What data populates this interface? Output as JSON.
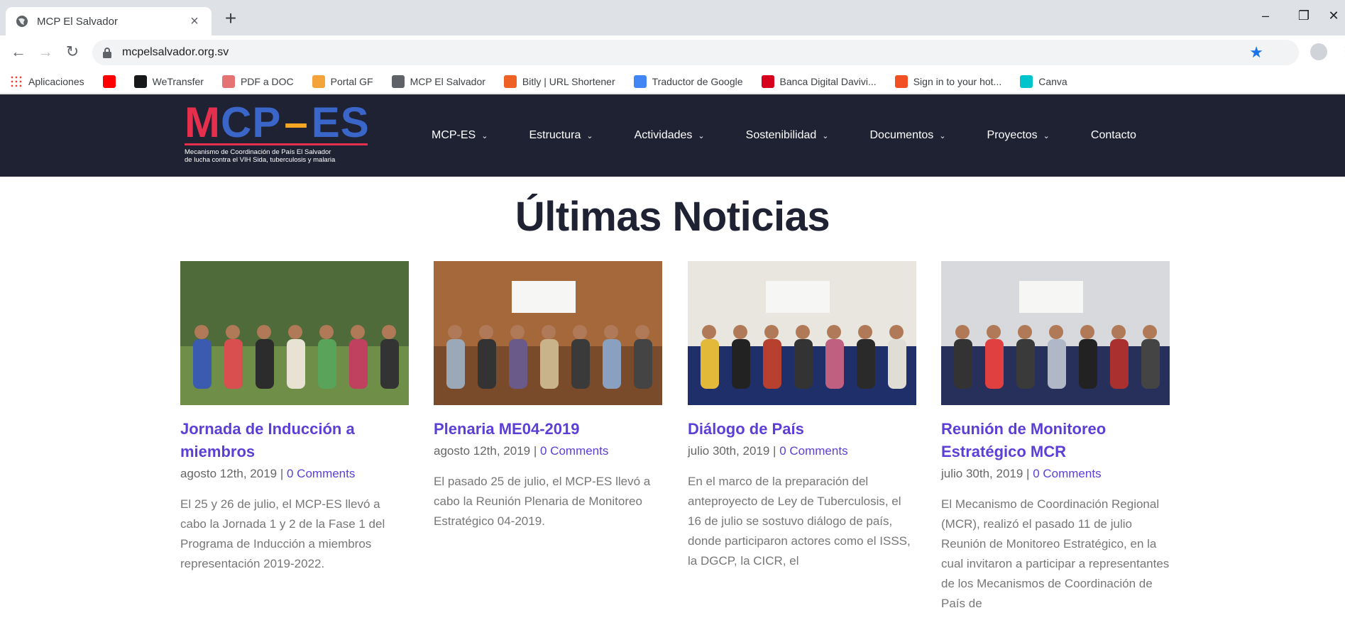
{
  "browser": {
    "tab_title": "MCP El Salvador",
    "new_tab": "+",
    "url": "mcpelsalvador.org.sv",
    "bookmarks": [
      {
        "label": "Aplicaciones",
        "icon": "apps-grid-icon",
        "color": "#ea4335"
      },
      {
        "label": "",
        "icon": "youtube-icon",
        "color": "#ff0000"
      },
      {
        "label": "WeTransfer",
        "icon": "wetransfer-icon",
        "color": "#17181a"
      },
      {
        "label": "PDF a DOC",
        "icon": "pdf-to-doc-icon",
        "color": "#e57373"
      },
      {
        "label": "Portal GF",
        "icon": "portal-gf-icon",
        "color": "#f4a23a"
      },
      {
        "label": "MCP El Salvador",
        "icon": "globe-icon",
        "color": "#5f6368"
      },
      {
        "label": "Bitly | URL Shortener",
        "icon": "bitly-icon",
        "color": "#ee6123"
      },
      {
        "label": "Traductor de Google",
        "icon": "google-translate-icon",
        "color": "#4285f4"
      },
      {
        "label": "Banca Digital Davivi...",
        "icon": "davivienda-icon",
        "color": "#d6001c"
      },
      {
        "label": "Sign in to your hot...",
        "icon": "microsoft-icon",
        "color": "#f25022"
      },
      {
        "label": "Canva",
        "icon": "canva-icon",
        "color": "#00c4cc"
      }
    ]
  },
  "site": {
    "logo_letters": [
      "M",
      "C",
      "P",
      "–",
      "ES"
    ],
    "logo_colors": [
      "#e62e4d",
      "#3a66c9",
      "#3a66c9",
      "#f5a623",
      "#3a66c9"
    ],
    "logo_subtitle_1": "Mecanismo de Coordinación de País El Salvador",
    "logo_subtitle_2": "de lucha contra el VIH Sida, tuberculosis y malaria",
    "menu": [
      {
        "label": "MCP-ES",
        "dropdown": true
      },
      {
        "label": "Estructura",
        "dropdown": true
      },
      {
        "label": "Actividades",
        "dropdown": true
      },
      {
        "label": "Sostenibilidad",
        "dropdown": true
      },
      {
        "label": "Documentos",
        "dropdown": true
      },
      {
        "label": "Proyectos",
        "dropdown": true
      },
      {
        "label": "Contacto",
        "dropdown": false
      }
    ]
  },
  "news": {
    "heading": "Últimas Noticias",
    "posts": [
      {
        "title": "Jornada de Inducción a miembros",
        "date": "agosto 12th, 2019",
        "sep": " | ",
        "comments": "0 Comments",
        "excerpt": "El 25 y 26 de julio, el MCP-ES llevó a cabo la Jornada 1 y 2 de la Fase 1 del Programa de Inducción a miembros representación 2019-2022.",
        "image": "group-photo-outdoor"
      },
      {
        "title": "Plenaria ME04-2019",
        "date": "agosto 12th, 2019",
        "sep": " | ",
        "comments": "0 Comments",
        "excerpt": "El pasado 25 de julio, el MCP-ES  llevó a cabo la Reunión Plenaria de Monitoreo Estratégico 04-2019.",
        "image": "meeting-wooden-hall"
      },
      {
        "title": "Diálogo de País",
        "date": "julio 30th, 2019",
        "sep": " | ",
        "comments": "0 Comments",
        "excerpt": "En el marco de la preparación del anteproyecto de Ley de Tuberculosis, el 16 de julio se sostuvo diálogo de país, donde participaron actores como el ISSS, la DGCP, la CICR, el",
        "image": "meeting-conference-room"
      },
      {
        "title": "Reunión de Monitoreo Estratégico MCR",
        "date": "julio 30th, 2019",
        "sep": " | ",
        "comments": "0 Comments",
        "excerpt": "El Mecanismo de Coordinación Regional (MCR), realizó el pasado 11 de julio Reunión de Monitoreo Estratégico, en la cual invitaron a participar a representantes de los Mecanismos de Coordinación de País de",
        "image": "meeting-presentation-room"
      }
    ]
  }
}
